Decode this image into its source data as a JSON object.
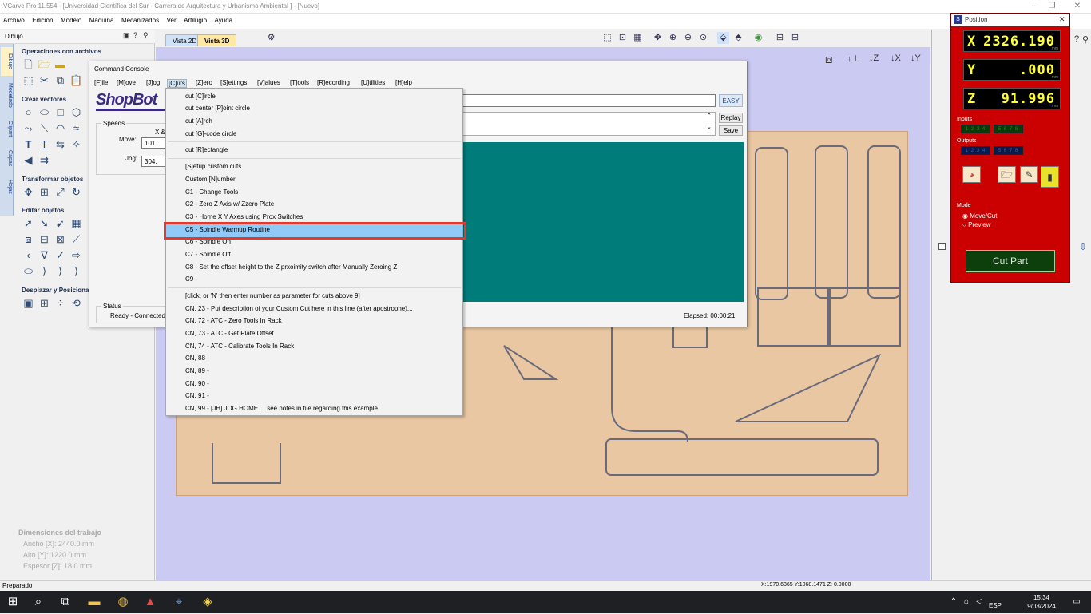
{
  "window": {
    "title": "VCarve Pro 11.554 - [Universidad Científica del Sur - Carrera de Arquitectura y Urbanismo Ambiental ] - [Nuevo]"
  },
  "menubar": [
    "Archivo",
    "Edición",
    "Modelo",
    "Máquina",
    "Mecanizados",
    "Ver",
    "Artilugio",
    "Ayuda"
  ],
  "left_panel": {
    "header": "Dibujo",
    "tabs": [
      "Dibujo",
      "Modelado",
      "Clipart",
      "Capas",
      "Hojas"
    ],
    "sections": [
      "Operaciones con archivos",
      "Crear vectores",
      "Transformar objetos",
      "Editar objetos",
      "Desplazar y Posicionar"
    ],
    "job_dims": {
      "title": "Dimensiones del trabajo",
      "width": "Ancho   [X]: 2440.0 mm",
      "height": "Alto   [Y]: 1220.0 mm",
      "thickness": "Espesor [Z]: 18.0 mm"
    }
  },
  "view_tabs": [
    "Vista 2D",
    "Vista 3D"
  ],
  "command_console": {
    "title": "Command Console",
    "menu": [
      "[F]ile",
      "[M]ove",
      "[J]og",
      "[C]uts",
      "[Z]ero",
      "[S]ettings",
      "[V]alues",
      "[T]ools",
      "[R]ecording",
      "[U]tilities",
      "[H]elp"
    ],
    "logo": "ShopBot",
    "speeds": {
      "title": "Speeds",
      "axis": "X &",
      "move_label": "Move:",
      "move_value": "101",
      "jog_label": "Jog:",
      "jog_value": "304."
    },
    "status": {
      "title": "Status",
      "value": "Ready - Connected"
    },
    "buttons": {
      "easy": "EASY",
      "replay": "Replay",
      "save": "Save"
    },
    "elapsed": "Elapsed: 00:00:21"
  },
  "cuts_menu": {
    "items": [
      "cut [C]ircle",
      "cut center [P]oint circle",
      "cut [A]rch",
      "cut [G]-code circle",
      "cut [R]ectangle",
      "[S]etup custom cuts",
      "Custom [N]umber",
      "C1  -  Change Tools",
      "C2  -  Zero Z Axis w/ Zzero Plate",
      "C3  -  Home X  Y Axes using Prox Switches",
      "C5  -  Spindle Warmup Routine",
      "C6  -  Spindle On",
      "C7  -  Spindle Off",
      "C8  -  Set the offset height to the Z prxoimity switch after Manually Zeroing Z",
      "C9  -",
      "[click, or 'N' then enter number as parameter for cuts above 9]",
      "CN, 23  -  Put description of your Custom Cut here in this line (after apostrophe)...",
      "CN, 72  -  ATC - Zero Tools In Rack",
      "CN, 73  -  ATC - Get Plate Offset",
      "CN, 74  -  ATC - Calibrate Tools In Rack",
      "CN, 88  -",
      "CN, 89  -",
      "CN, 90  -",
      "CN, 91  -",
      "CN, 99  -  [JH] JOG HOME ... see notes in file regarding this example"
    ],
    "highlighted_index": 10
  },
  "position_panel": {
    "title": "Position",
    "x_axis": "X",
    "x": "2326.190",
    "y_axis": "Y",
    "y": ".000",
    "z_axis": "Z",
    "z": "91.996",
    "unit": "mm",
    "inputs_label": "Inputs",
    "inputs": [
      "1 2 3 4",
      "5 6 7 8"
    ],
    "outputs_label": "Outputs",
    "outputs": [
      "1 2 3 4",
      "5 6 7 8"
    ],
    "mode_label": "Mode",
    "mode_options": [
      "Move/Cut",
      "Preview"
    ],
    "cut_part": "Cut Part"
  },
  "status_bar": {
    "left": "Preparado",
    "coords": "X:1970.6365 Y:1068.1471 Z: 0.0000"
  },
  "taskbar": {
    "lang": "ESP",
    "time": "15:34",
    "date": "9/03/2024"
  }
}
